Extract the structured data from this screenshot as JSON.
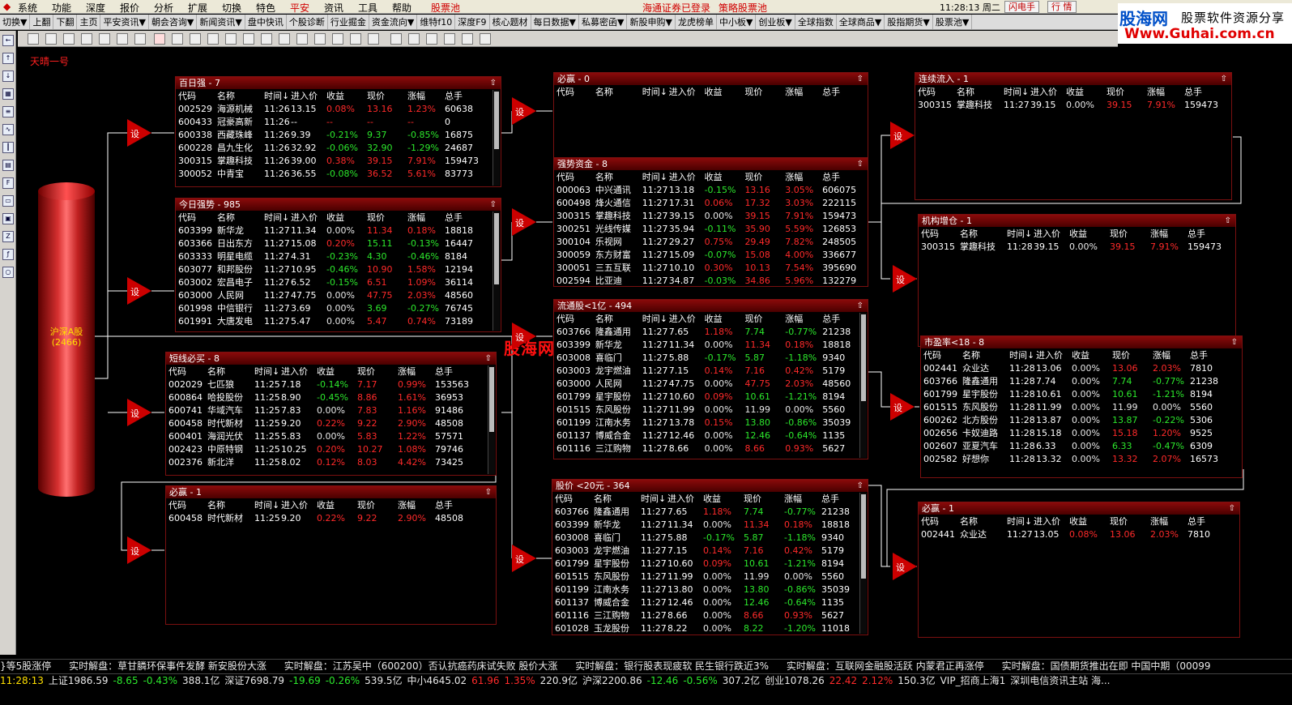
{
  "menu": {
    "items": [
      "系统",
      "功能",
      "深度",
      "报价",
      "分析",
      "扩展",
      "切换",
      "特色",
      "平安",
      "资讯",
      "工具",
      "帮助",
      "股票池"
    ],
    "login": "海通证券已登录",
    "pool": "策略股票池",
    "clock": "11:28:13 周二",
    "flash": "闪电手",
    "market": "行 情"
  },
  "nav": [
    "切换▼",
    "上翻",
    "下翻",
    "主页",
    "平安资讯▼",
    "朝会咨询▼",
    "新闻资讯▼",
    "盘中快讯",
    "个股诊断",
    "行业掘金",
    "资金流向▼",
    "维特f10",
    "深度F9",
    "核心题材",
    "每日数据▼",
    "私募密函▼",
    "新股申购▼",
    "龙虎榜单",
    "中小板▼",
    "创业板▼",
    "全球指数",
    "全球商品▼",
    "股指期货▼",
    "股票池▼"
  ],
  "logo": {
    "brand": "股海网",
    "slogan": "股票软件资源分享",
    "url": "Www.Guhai.com.cn"
  },
  "canvas_title": "天晴一号",
  "source": {
    "label": "沪深A股",
    "count": "(2466)"
  },
  "setter_label": "设",
  "watermark": "股海网 Www.Guhai.Com.CN",
  "headers": [
    "代码",
    "名称",
    "时间↓",
    "进入价",
    "收益",
    "现价",
    "涨幅",
    "总手"
  ],
  "panels": [
    {
      "id": "bqq",
      "title": "百日强 - 7",
      "rows": [
        [
          "002529",
          "海源机械",
          "11:26",
          "13.15",
          "0.08%",
          "13.16",
          "1.23%",
          "60638",
          "r",
          "r",
          "r"
        ],
        [
          "600433",
          "冠豪高新",
          "11:26",
          "--",
          "--",
          "--",
          "--",
          "0",
          "r",
          "r",
          "r"
        ],
        [
          "600338",
          "西藏珠峰",
          "11:26",
          "9.39",
          "-0.21%",
          "9.37",
          "-0.85%",
          "16875",
          "g",
          "g",
          "g"
        ],
        [
          "600228",
          "昌九生化",
          "11:26",
          "32.92",
          "-0.06%",
          "32.90",
          "-1.29%",
          "24687",
          "g",
          "g",
          "g"
        ],
        [
          "300315",
          "掌趣科技",
          "11:26",
          "39.00",
          "0.38%",
          "39.15",
          "7.91%",
          "159473",
          "r",
          "r",
          "r"
        ],
        [
          "300052",
          "中青宝",
          "11:26",
          "36.55",
          "-0.08%",
          "36.52",
          "5.61%",
          "83773",
          "g",
          "r",
          "r"
        ]
      ]
    },
    {
      "id": "jrqs",
      "title": "今日强势 - 985",
      "rows": [
        [
          "603399",
          "新华龙",
          "11:27",
          "11.34",
          "0.00%",
          "11.34",
          "0.18%",
          "18818",
          "w",
          "r",
          "r"
        ],
        [
          "603366",
          "日出东方",
          "11:27",
          "15.08",
          "0.20%",
          "15.11",
          "-0.13%",
          "16447",
          "r",
          "g",
          "g"
        ],
        [
          "603333",
          "明星电缆",
          "11:27",
          "4.31",
          "-0.23%",
          "4.30",
          "-0.46%",
          "8184",
          "g",
          "g",
          "g"
        ],
        [
          "603077",
          "和邦股份",
          "11:27",
          "10.95",
          "-0.46%",
          "10.90",
          "1.58%",
          "12194",
          "g",
          "r",
          "r"
        ],
        [
          "603002",
          "宏昌电子",
          "11:27",
          "6.52",
          "-0.15%",
          "6.51",
          "1.09%",
          "36114",
          "g",
          "r",
          "r"
        ],
        [
          "603000",
          "人民网",
          "11:27",
          "47.75",
          "0.00%",
          "47.75",
          "2.03%",
          "48560",
          "w",
          "r",
          "r"
        ],
        [
          "601998",
          "中信银行",
          "11:27",
          "3.69",
          "0.00%",
          "3.69",
          "-0.27%",
          "76745",
          "w",
          "g",
          "g"
        ],
        [
          "601991",
          "大唐发电",
          "11:27",
          "5.47",
          "0.00%",
          "5.47",
          "0.74%",
          "73189",
          "w",
          "r",
          "r"
        ]
      ]
    },
    {
      "id": "dxbm",
      "title": "短线必买 - 8",
      "rows": [
        [
          "002029",
          "七匹狼",
          "11:25",
          "7.18",
          "-0.14%",
          "7.17",
          "0.99%",
          "153563",
          "g",
          "r",
          "r"
        ],
        [
          "600864",
          "哈投股份",
          "11:25",
          "8.90",
          "-0.45%",
          "8.86",
          "1.61%",
          "36953",
          "g",
          "r",
          "r"
        ],
        [
          "600741",
          "华域汽车",
          "11:25",
          "7.83",
          "0.00%",
          "7.83",
          "1.16%",
          "91486",
          "w",
          "r",
          "r"
        ],
        [
          "600458",
          "时代新材",
          "11:25",
          "9.20",
          "0.22%",
          "9.22",
          "2.90%",
          "48508",
          "r",
          "r",
          "r"
        ],
        [
          "600401",
          "海润光伏",
          "11:25",
          "5.83",
          "0.00%",
          "5.83",
          "1.22%",
          "57571",
          "w",
          "r",
          "r"
        ],
        [
          "002423",
          "中原特钢",
          "11:25",
          "10.25",
          "0.20%",
          "10.27",
          "1.08%",
          "79746",
          "r",
          "r",
          "r"
        ],
        [
          "002376",
          "新北洋",
          "11:25",
          "8.02",
          "0.12%",
          "8.03",
          "4.42%",
          "73425",
          "r",
          "r",
          "r"
        ]
      ]
    },
    {
      "id": "bz1",
      "title": "必赢 - 1",
      "rows": [
        [
          "600458",
          "时代新材",
          "11:25",
          "9.20",
          "0.22%",
          "9.22",
          "2.90%",
          "48508",
          "r",
          "r",
          "r"
        ]
      ]
    },
    {
      "id": "bz0",
      "title": "必赢 - 0",
      "rows": []
    },
    {
      "id": "qszj",
      "title": "强势资金 - 8",
      "rows": [
        [
          "000063",
          "中兴通讯",
          "11:27",
          "13.18",
          "-0.15%",
          "13.16",
          "3.05%",
          "606075",
          "g",
          "r",
          "r"
        ],
        [
          "600498",
          "烽火通信",
          "11:27",
          "17.31",
          "0.06%",
          "17.32",
          "3.03%",
          "222115",
          "r",
          "r",
          "r"
        ],
        [
          "300315",
          "掌趣科技",
          "11:27",
          "39.15",
          "0.00%",
          "39.15",
          "7.91%",
          "159473",
          "w",
          "r",
          "r"
        ],
        [
          "300251",
          "光线传媒",
          "11:27",
          "35.94",
          "-0.11%",
          "35.90",
          "5.59%",
          "126853",
          "g",
          "r",
          "r"
        ],
        [
          "300104",
          "乐视网",
          "11:27",
          "29.27",
          "0.75%",
          "29.49",
          "7.82%",
          "248505",
          "r",
          "r",
          "r"
        ],
        [
          "300059",
          "东方财富",
          "11:27",
          "15.09",
          "-0.07%",
          "15.08",
          "4.00%",
          "336677",
          "g",
          "r",
          "r"
        ],
        [
          "300051",
          "三五互联",
          "11:27",
          "10.10",
          "0.30%",
          "10.13",
          "7.54%",
          "395690",
          "r",
          "r",
          "r"
        ],
        [
          "002594",
          "比亚迪",
          "11:27",
          "34.87",
          "-0.03%",
          "34.86",
          "5.96%",
          "132279",
          "g",
          "r",
          "r"
        ]
      ]
    },
    {
      "id": "ltg",
      "title": "流通股<1亿 - 494",
      "rows": [
        [
          "603766",
          "隆鑫通用",
          "11:27",
          "7.65",
          "1.18%",
          "7.74",
          "-0.77%",
          "21238",
          "r",
          "g",
          "g"
        ],
        [
          "603399",
          "新华龙",
          "11:27",
          "11.34",
          "0.00%",
          "11.34",
          "0.18%",
          "18818",
          "w",
          "r",
          "r"
        ],
        [
          "603008",
          "喜临门",
          "11:27",
          "5.88",
          "-0.17%",
          "5.87",
          "-1.18%",
          "9340",
          "g",
          "g",
          "g"
        ],
        [
          "603003",
          "龙宇燃油",
          "11:27",
          "7.15",
          "0.14%",
          "7.16",
          "0.42%",
          "5179",
          "r",
          "r",
          "r"
        ],
        [
          "603000",
          "人民网",
          "11:27",
          "47.75",
          "0.00%",
          "47.75",
          "2.03%",
          "48560",
          "w",
          "r",
          "r"
        ],
        [
          "601799",
          "星宇股份",
          "11:27",
          "10.60",
          "0.09%",
          "10.61",
          "-1.21%",
          "8194",
          "r",
          "g",
          "g"
        ],
        [
          "601515",
          "东风股份",
          "11:27",
          "11.99",
          "0.00%",
          "11.99",
          "0.00%",
          "5560",
          "w",
          "w",
          "w"
        ],
        [
          "601199",
          "江南水务",
          "11:27",
          "13.78",
          "0.15%",
          "13.80",
          "-0.86%",
          "35039",
          "r",
          "g",
          "g"
        ],
        [
          "601137",
          "博威合金",
          "11:27",
          "12.46",
          "0.00%",
          "12.46",
          "-0.64%",
          "1135",
          "w",
          "g",
          "g"
        ],
        [
          "601116",
          "三江购物",
          "11:27",
          "8.66",
          "0.00%",
          "8.66",
          "0.93%",
          "5627",
          "w",
          "r",
          "r"
        ]
      ]
    },
    {
      "id": "gj20",
      "title": "股价 <20元 - 364",
      "rows": [
        [
          "603766",
          "隆鑫通用",
          "11:27",
          "7.65",
          "1.18%",
          "7.74",
          "-0.77%",
          "21238",
          "r",
          "g",
          "g"
        ],
        [
          "603399",
          "新华龙",
          "11:27",
          "11.34",
          "0.00%",
          "11.34",
          "0.18%",
          "18818",
          "w",
          "r",
          "r"
        ],
        [
          "603008",
          "喜临门",
          "11:27",
          "5.88",
          "-0.17%",
          "5.87",
          "-1.18%",
          "9340",
          "g",
          "g",
          "g"
        ],
        [
          "603003",
          "龙宇燃油",
          "11:27",
          "7.15",
          "0.14%",
          "7.16",
          "0.42%",
          "5179",
          "r",
          "r",
          "r"
        ],
        [
          "601799",
          "星宇股份",
          "11:27",
          "10.60",
          "0.09%",
          "10.61",
          "-1.21%",
          "8194",
          "r",
          "g",
          "g"
        ],
        [
          "601515",
          "东风股份",
          "11:27",
          "11.99",
          "0.00%",
          "11.99",
          "0.00%",
          "5560",
          "w",
          "w",
          "w"
        ],
        [
          "601199",
          "江南水务",
          "11:27",
          "13.80",
          "0.00%",
          "13.80",
          "-0.86%",
          "35039",
          "w",
          "g",
          "g"
        ],
        [
          "601137",
          "博威合金",
          "11:27",
          "12.46",
          "0.00%",
          "12.46",
          "-0.64%",
          "1135",
          "w",
          "g",
          "g"
        ],
        [
          "601116",
          "三江购物",
          "11:27",
          "8.66",
          "0.00%",
          "8.66",
          "0.93%",
          "5627",
          "w",
          "r",
          "r"
        ],
        [
          "601028",
          "玉龙股份",
          "11:27",
          "8.22",
          "0.00%",
          "8.22",
          "-1.20%",
          "11018",
          "w",
          "g",
          "g"
        ]
      ]
    },
    {
      "id": "lxlr",
      "title": "连续流入 - 1",
      "rows": [
        [
          "300315",
          "掌趣科技",
          "11:27",
          "39.15",
          "0.00%",
          "39.15",
          "7.91%",
          "159473",
          "w",
          "r",
          "r"
        ]
      ]
    },
    {
      "id": "jgzc",
      "title": "机构增仓 - 1",
      "rows": [
        [
          "300315",
          "掌趣科技",
          "11:28",
          "39.15",
          "0.00%",
          "39.15",
          "7.91%",
          "159473",
          "w",
          "r",
          "r"
        ]
      ]
    },
    {
      "id": "syl",
      "title": "市盈率<18 - 8",
      "rows": [
        [
          "002441",
          "众业达",
          "11:28",
          "13.06",
          "0.00%",
          "13.06",
          "2.03%",
          "7810",
          "w",
          "r",
          "r"
        ],
        [
          "603766",
          "隆鑫通用",
          "11:28",
          "7.74",
          "0.00%",
          "7.74",
          "-0.77%",
          "21238",
          "w",
          "g",
          "g"
        ],
        [
          "601799",
          "星宇股份",
          "11:28",
          "10.61",
          "0.00%",
          "10.61",
          "-1.21%",
          "8194",
          "w",
          "g",
          "g"
        ],
        [
          "601515",
          "东风股份",
          "11:28",
          "11.99",
          "0.00%",
          "11.99",
          "0.00%",
          "5560",
          "w",
          "w",
          "w"
        ],
        [
          "600262",
          "北方股份",
          "11:28",
          "13.87",
          "0.00%",
          "13.87",
          "-0.22%",
          "5306",
          "w",
          "g",
          "g"
        ],
        [
          "002656",
          "卡奴迪路",
          "11:28",
          "15.18",
          "0.00%",
          "15.18",
          "1.20%",
          "9525",
          "w",
          "r",
          "r"
        ],
        [
          "002607",
          "亚夏汽车",
          "11:28",
          "6.33",
          "0.00%",
          "6.33",
          "-0.47%",
          "6309",
          "w",
          "g",
          "g"
        ],
        [
          "002582",
          "好想你",
          "11:28",
          "13.32",
          "0.00%",
          "13.32",
          "2.07%",
          "16573",
          "w",
          "r",
          "r"
        ]
      ]
    },
    {
      "id": "bz2",
      "title": "必赢 - 1",
      "rows": [
        [
          "002441",
          "众业达",
          "11:27",
          "13.05",
          "0.08%",
          "13.06",
          "2.03%",
          "7810",
          "r",
          "r",
          "r"
        ]
      ]
    }
  ],
  "ticker": [
    "}等5股涨停",
    "实时解盘：草甘膦环保事件发酵 新安股份大涨",
    "实时解盘：江苏吴中（600200）否认抗癌药床试失败 股价大涨",
    "实时解盘：银行股表现疲软 民生银行跌近3%",
    "实时解盘：互联网金融股活跃 内蒙君正再涨停",
    "实时解盘：国债期货推出在即 中国中期（00099"
  ],
  "status": [
    [
      "11:28:13",
      "w"
    ],
    [
      "上证1986.59",
      "w"
    ],
    [
      "-8.65",
      "g"
    ],
    [
      "-0.43%",
      "g"
    ],
    [
      "388.1亿",
      "w"
    ],
    [
      "深证7698.79",
      "w"
    ],
    [
      "-19.69",
      "g"
    ],
    [
      "-0.26%",
      "g"
    ],
    [
      "539.5亿",
      "w"
    ],
    [
      "中小4645.02",
      "w"
    ],
    [
      "61.96",
      "r"
    ],
    [
      "1.35%",
      "r"
    ],
    [
      "220.9亿",
      "w"
    ],
    [
      "沪深2200.86",
      "w"
    ],
    [
      "-12.46",
      "g"
    ],
    [
      "-0.56%",
      "g"
    ],
    [
      "307.2亿",
      "w"
    ],
    [
      "创业1078.26",
      "w"
    ],
    [
      "22.42",
      "r"
    ],
    [
      "2.12%",
      "r"
    ],
    [
      "150.3亿",
      "w"
    ],
    [
      "VIP_招商上海1",
      "w"
    ],
    [
      "深圳电信资讯主站 海...",
      "w"
    ]
  ]
}
